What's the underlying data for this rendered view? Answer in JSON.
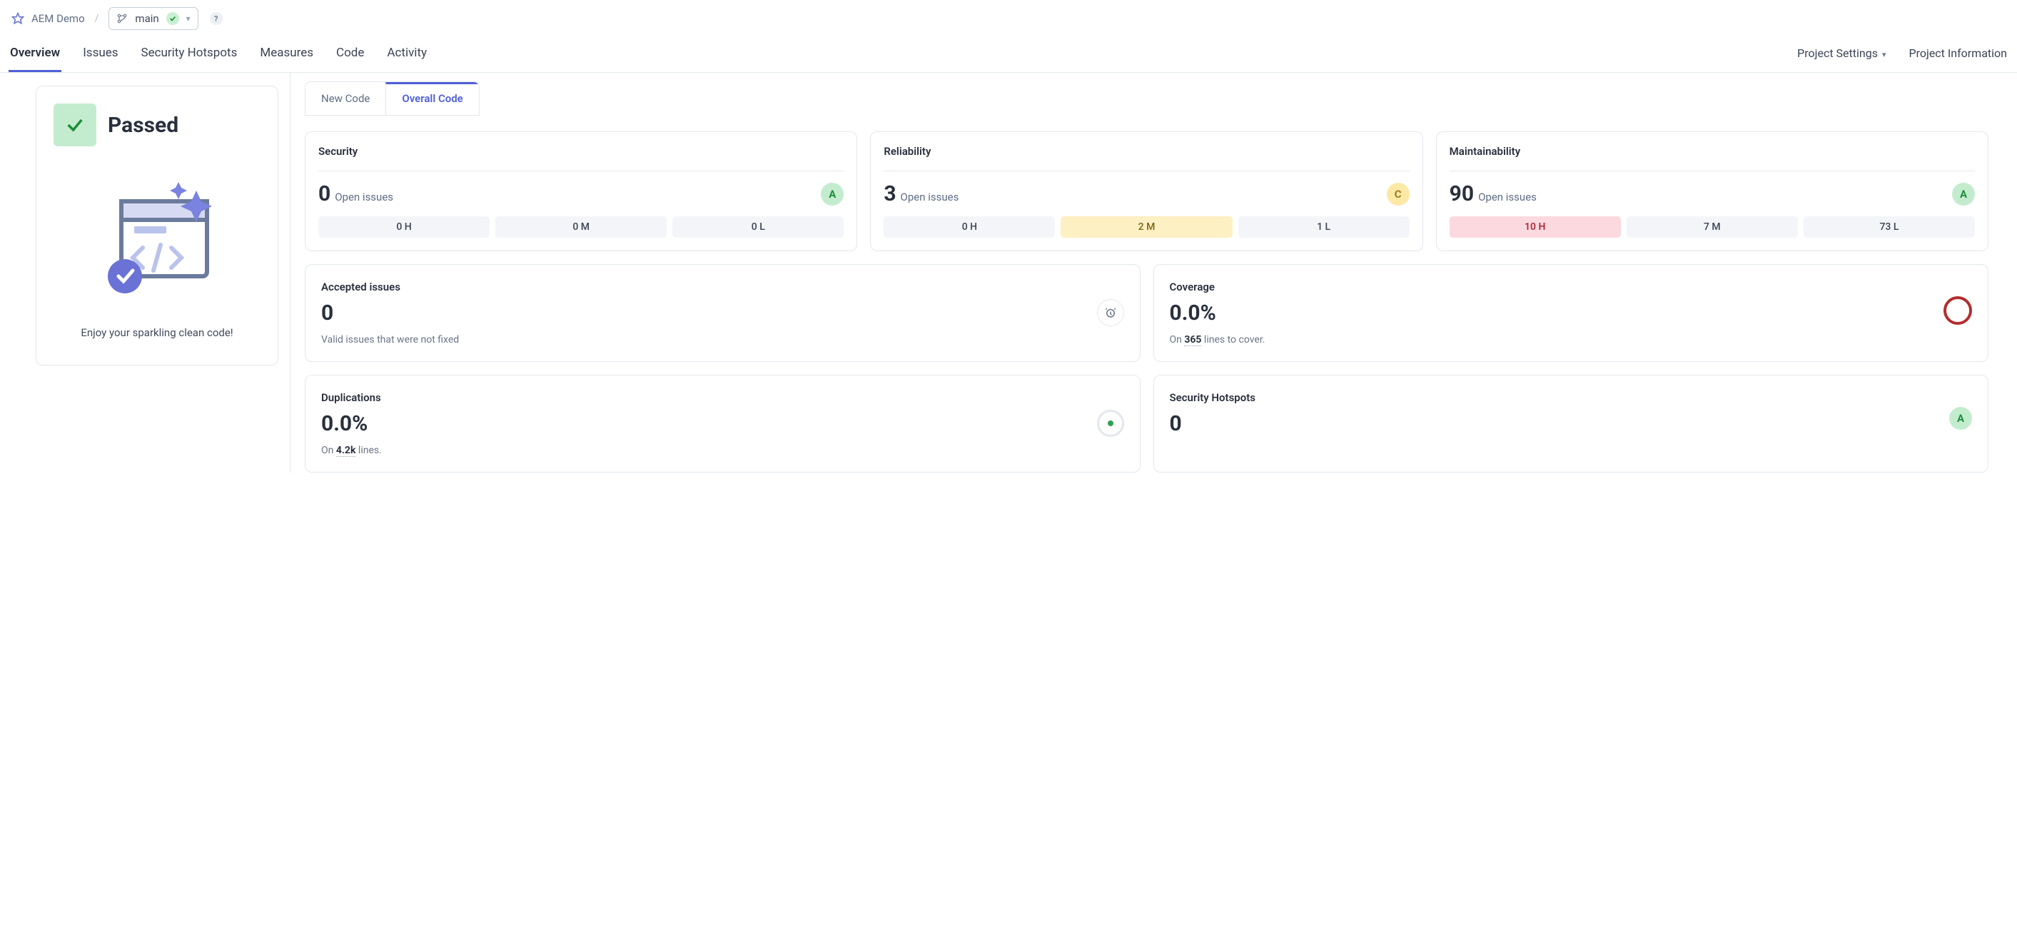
{
  "breadcrumb": {
    "project": "AEM Demo"
  },
  "branch": {
    "name": "main"
  },
  "nav": {
    "items": [
      "Overview",
      "Issues",
      "Security Hotspots",
      "Measures",
      "Code",
      "Activity"
    ],
    "settings": "Project Settings",
    "info": "Project Information"
  },
  "status": {
    "label": "Passed",
    "tagline": "Enjoy your sparkling clean code!"
  },
  "tabs": {
    "new": "New Code",
    "overall": "Overall Code"
  },
  "metrics": {
    "security": {
      "title": "Security",
      "count": "0",
      "label": "Open issues",
      "grade": "A",
      "sev": [
        "0 H",
        "0 M",
        "0 L"
      ]
    },
    "reliability": {
      "title": "Reliability",
      "count": "3",
      "label": "Open issues",
      "grade": "C",
      "sev": [
        "0 H",
        "2 M",
        "1 L"
      ]
    },
    "maintainability": {
      "title": "Maintainability",
      "count": "90",
      "label": "Open issues",
      "grade": "A",
      "sev": [
        "10 H",
        "7 M",
        "73 L"
      ]
    }
  },
  "accepted": {
    "title": "Accepted issues",
    "value": "0",
    "sub": "Valid issues that were not fixed"
  },
  "coverage": {
    "title": "Coverage",
    "value": "0.0%",
    "sub_pre": "On ",
    "lines": "365",
    "sub_post": " lines to cover."
  },
  "duplications": {
    "title": "Duplications",
    "value": "0.0%",
    "sub_pre": "On ",
    "lines": "4.2k",
    "sub_post": " lines."
  },
  "hotspots": {
    "title": "Security Hotspots",
    "value": "0",
    "grade": "A"
  }
}
